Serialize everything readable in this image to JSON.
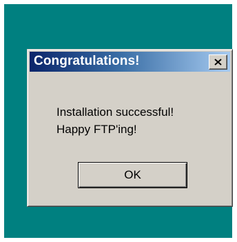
{
  "dialog": {
    "title": "Congratulations!",
    "close_icon": "close-icon",
    "message_lines": [
      "Installation successful!",
      "Happy FTP'ing!"
    ],
    "ok_label": "OK"
  },
  "colors": {
    "desktop": "#008080",
    "dialog_face": "#d4d0c8",
    "titlebar_start": "#0a246a",
    "titlebar_end": "#a6caf0",
    "title_text": "#ffffff"
  }
}
